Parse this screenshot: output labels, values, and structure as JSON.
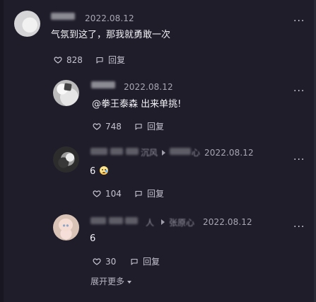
{
  "comments": [
    {
      "date": "2022.08.12",
      "text": "气氛到这了，那我就勇敢一次",
      "likes": "828",
      "reply_label": "回复",
      "more_label": "···"
    },
    {
      "date": "2022.08.12",
      "text": "@拳王泰森 出来单挑!",
      "likes": "748",
      "reply_label": "回复",
      "more_label": "···"
    },
    {
      "username_fragment_1": "沉风",
      "username_fragment_2": "心",
      "date": "2022.08.12",
      "text": "6",
      "likes": "104",
      "reply_label": "回复",
      "more_label": "···"
    },
    {
      "username_fragment_1": "人",
      "username_fragment_2": "张原心",
      "date": "2022.08.12",
      "text": "6",
      "likes": "30",
      "reply_label": "回复",
      "more_label": "···"
    }
  ],
  "expand_more_label": "展开更多"
}
